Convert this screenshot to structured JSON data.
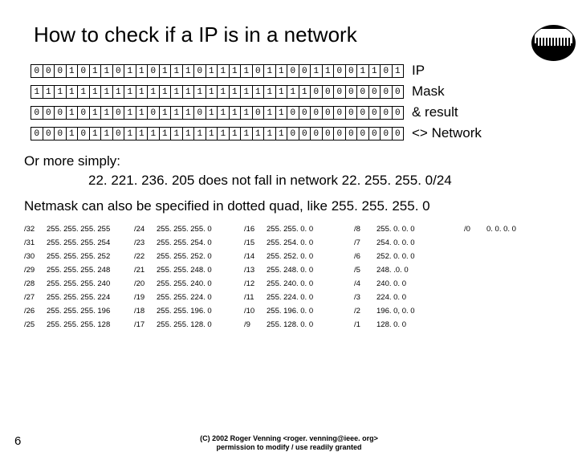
{
  "title": "How to check if a IP is in a network",
  "logo_text": "MELBOURNE WIRELESS",
  "bitrows": [
    {
      "label": "IP",
      "bits": "00010110110111011110110011001101"
    },
    {
      "label": "Mask",
      "bits": "11111111111111111111111100000000"
    },
    {
      "label": "& result",
      "bits": "00010110110111011110110000000000"
    },
    {
      "label": "<> Network",
      "bits": "00010110111111111111110000000000"
    }
  ],
  "simply_label": "Or more simply:",
  "simply_text": "22. 221. 236. 205 does not fall in network 22. 255. 255. 0/24",
  "netmask_text": "Netmask can also be specified in dotted quad, like 255. 255. 255. 0",
  "mask_table": [
    [
      {
        "cidr": "/32",
        "mask": "255. 255. 255. 255"
      },
      {
        "cidr": "/31",
        "mask": "255. 255. 255. 254"
      },
      {
        "cidr": "/30",
        "mask": "255. 255. 255. 252"
      },
      {
        "cidr": "/29",
        "mask": "255. 255. 255. 248"
      },
      {
        "cidr": "/28",
        "mask": "255. 255. 255. 240"
      },
      {
        "cidr": "/27",
        "mask": "255. 255. 255. 224"
      },
      {
        "cidr": "/26",
        "mask": "255. 255. 255. 196"
      },
      {
        "cidr": "/25",
        "mask": "255. 255. 255. 128"
      }
    ],
    [
      {
        "cidr": "/24",
        "mask": "255. 255. 255. 0"
      },
      {
        "cidr": "/23",
        "mask": "255. 255. 254. 0"
      },
      {
        "cidr": "/22",
        "mask": "255. 255. 252. 0"
      },
      {
        "cidr": "/21",
        "mask": "255. 255. 248. 0"
      },
      {
        "cidr": "/20",
        "mask": "255. 255. 240. 0"
      },
      {
        "cidr": "/19",
        "mask": "255. 255. 224. 0"
      },
      {
        "cidr": "/18",
        "mask": "255. 255. 196. 0"
      },
      {
        "cidr": "/17",
        "mask": "255. 255. 128. 0"
      }
    ],
    [
      {
        "cidr": "/16",
        "mask": "255. 255. 0. 0"
      },
      {
        "cidr": "/15",
        "mask": "255. 254. 0. 0"
      },
      {
        "cidr": "/14",
        "mask": "255. 252. 0. 0"
      },
      {
        "cidr": "/13",
        "mask": "255. 248. 0. 0"
      },
      {
        "cidr": "/12",
        "mask": "255. 240. 0. 0"
      },
      {
        "cidr": "/11",
        "mask": "255. 224. 0. 0"
      },
      {
        "cidr": "/10",
        "mask": "255. 196. 0. 0"
      },
      {
        "cidr": "/9",
        "mask": "255. 128. 0. 0"
      }
    ],
    [
      {
        "cidr": "/8",
        "mask": "255. 0. 0. 0"
      },
      {
        "cidr": "/7",
        "mask": "254. 0. 0. 0"
      },
      {
        "cidr": "/6",
        "mask": "252. 0. 0. 0"
      },
      {
        "cidr": "/5",
        "mask": "248. .0. 0"
      },
      {
        "cidr": "/4",
        "mask": "240. 0. 0"
      },
      {
        "cidr": "/3",
        "mask": "224. 0. 0"
      },
      {
        "cidr": "/2",
        "mask": "196. 0, 0. 0"
      },
      {
        "cidr": "/1",
        "mask": "128. 0. 0"
      }
    ],
    [
      {
        "cidr": "/0",
        "mask": "0. 0. 0. 0"
      }
    ]
  ],
  "footer_line1": "(C) 2002 Roger Venning <roger. venning@ieee. org>",
  "footer_line2": "permission to modify / use readily granted",
  "page_number": "6"
}
